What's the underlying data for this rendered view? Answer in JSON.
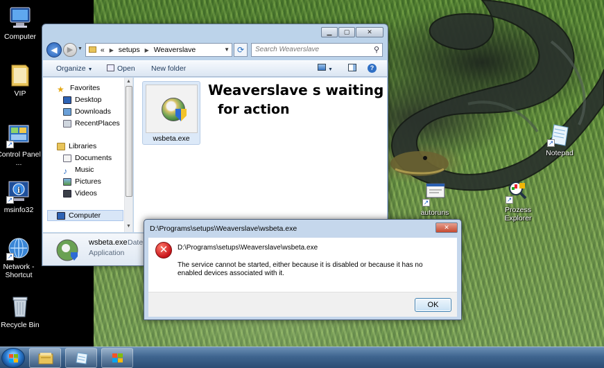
{
  "desktop": {
    "icons": [
      {
        "label": "Computer",
        "icon": "computer-icon"
      },
      {
        "label": "VIP",
        "icon": "folder-icon"
      },
      {
        "label": "Control Panel ...",
        "icon": "control-panel-icon"
      },
      {
        "label": "msinfo32",
        "icon": "info-icon"
      },
      {
        "label": "Network - Shortcut",
        "icon": "network-icon"
      },
      {
        "label": "Recycle Bin",
        "icon": "recycle-bin-icon"
      },
      {
        "label": "Notepad",
        "icon": "notepad-icon"
      },
      {
        "label": "autoruns",
        "icon": "autoruns-icon"
      },
      {
        "label": "Prozess Explorer",
        "icon": "process-explorer-icon"
      }
    ]
  },
  "explorer": {
    "breadcrumb": [
      "«",
      "setups",
      "Weaverslave"
    ],
    "search_placeholder": "Search Weaverslave",
    "toolbar": {
      "organize": "Organize",
      "open": "Open",
      "new_folder": "New folder"
    },
    "nav": {
      "favorites": "Favorites",
      "desktop": "Desktop",
      "downloads": "Downloads",
      "recent_places": "RecentPlaces",
      "libraries": "Libraries",
      "documents": "Documents",
      "music": "Music",
      "pictures": "Pictures",
      "videos": "Videos",
      "computer": "Computer"
    },
    "file": {
      "name": "wsbeta.exe"
    },
    "overlay_line1": "Weaverslave s waiting",
    "overlay_line2": "for action",
    "details": {
      "name": "wsbeta.exe",
      "type": "Application",
      "date_label": "Date"
    }
  },
  "dialog": {
    "title": "D:\\Programs\\setups\\Weaverslave\\wsbeta.exe",
    "path": "D:\\Programs\\setups\\Weaverslave\\wsbeta.exe",
    "message": "The service cannot be started, either because it is disabled or because it has no enabled devices associated with it.",
    "ok": "OK"
  },
  "taskbar": {
    "items": [
      "start-button",
      "explorer-task",
      "notepad-task",
      "installer-task"
    ]
  },
  "colors": {
    "accent": "#2f7fd4",
    "error": "#c8141b",
    "taskbar": "#3f658f"
  }
}
